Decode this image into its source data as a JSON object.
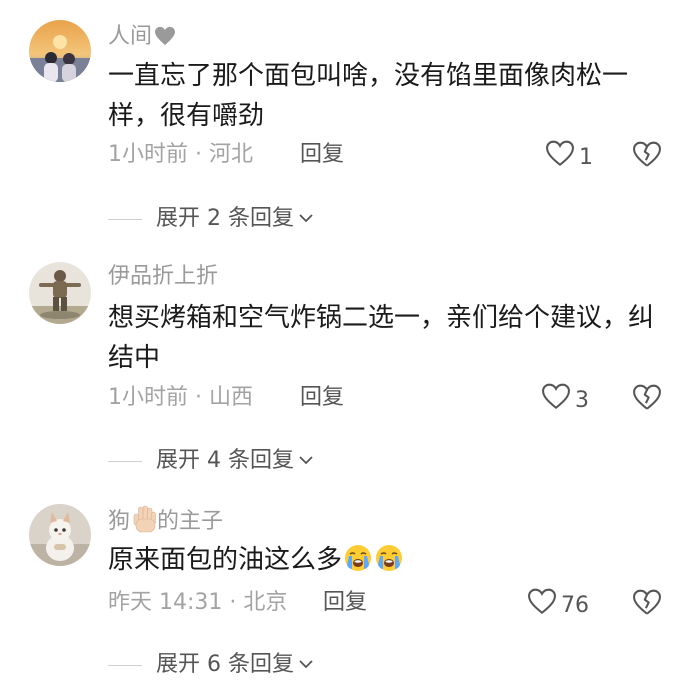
{
  "comments": [
    {
      "username": "人间",
      "text": "一直忘了那个面包叫啥，没有馅里面像肉松一样，很有嚼劲",
      "meta": "1小时前 · 河北",
      "reply_label": "回复",
      "like_count": "1",
      "expand_label": "展开 2 条回复"
    },
    {
      "username": "伊品折上折",
      "text": "想买烤箱和空气炸锅二选一，亲们给个建议，纠结中",
      "meta": "1小时前 · 山西",
      "reply_label": "回复",
      "like_count": "3",
      "expand_label": "展开 4 条回复"
    },
    {
      "username_prefix": "狗",
      "username_suffix": "的主子",
      "text": "原来面包的油这么多",
      "meta": "昨天 14:31 · 北京",
      "reply_label": "回复",
      "like_count": "76",
      "expand_label": "展开 6 条回复"
    }
  ],
  "icons": {
    "like": "heart-outline-icon",
    "dislike": "broken-heart-icon",
    "expand": "chevron-down-icon",
    "username_badge": "heart-icon",
    "hand": "raised-hand-emoji",
    "crying": "loudly-crying-face-emoji"
  },
  "colors": {
    "text": "#1a1a1a",
    "secondary": "#9a9a9a",
    "action": "#555555"
  }
}
